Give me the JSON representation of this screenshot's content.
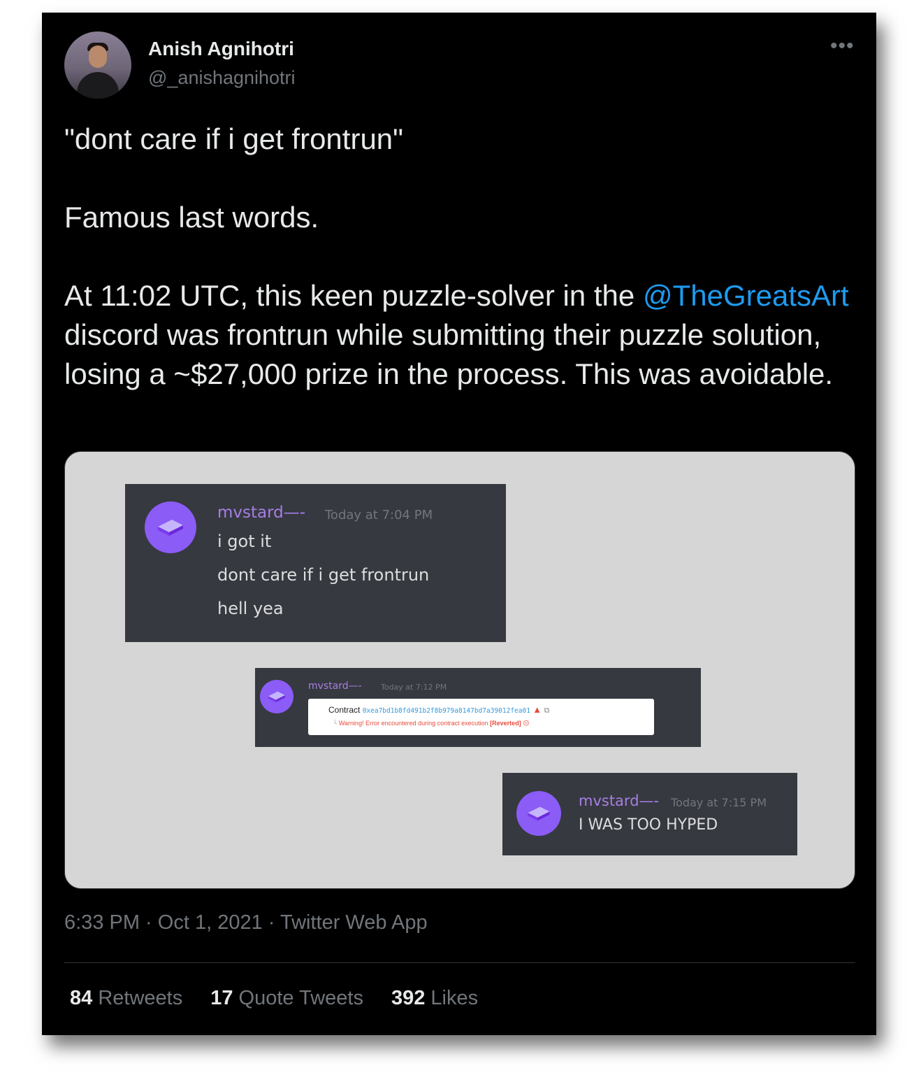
{
  "author": {
    "name": "Anish Agnihotri",
    "handle": "@_anishagnihotri"
  },
  "tweet": {
    "line1": "\"dont care if i get frontrun\"",
    "line2": "Famous last words.",
    "line3_before": "At 11:02 UTC, this keen puzzle-solver in the ",
    "mention": "@TheGreatsArt",
    "line3_after": " discord was frontrun while submitting their puzzle solution, losing a ~$27,000 prize in the process. This was avoidable."
  },
  "media": {
    "msg1": {
      "username": "mvstard—-",
      "timestamp": "Today at 7:04 PM",
      "lines": [
        "i got it",
        "dont care if i get frontrun",
        "hell yea"
      ]
    },
    "msg2": {
      "username": "mvstard—-",
      "timestamp": "Today at 7:12 PM",
      "contract_label": "Contract",
      "contract_address": "0xea7bd1b8fd491b2f8b979a8147bd7a39012fea01",
      "warning_prefix": "Warning! Error encountered during contract execution ",
      "warning_status": "[Reverted]"
    },
    "msg3": {
      "username": "mvstard—-",
      "timestamp": "Today at 7:15 PM",
      "line": "I WAS TOO HYPED"
    }
  },
  "meta": {
    "time": "6:33 PM",
    "date": "Oct 1, 2021",
    "source": "Twitter Web App",
    "separator": " · "
  },
  "stats": {
    "retweets_count": "84",
    "retweets_label": "Retweets",
    "quotes_count": "17",
    "quotes_label": "Quote Tweets",
    "likes_count": "392",
    "likes_label": "Likes"
  },
  "icons": {
    "more": "more-icon",
    "avatar": "brick-icon",
    "warning": "warning-icon",
    "copy": "copy-icon"
  },
  "colors": {
    "background": "#000000",
    "text": "#e7e9ea",
    "secondary": "#71767b",
    "mention": "#1d9bf0",
    "discord_bg": "#36393f",
    "discord_username": "#a77ee6",
    "discord_avatar": "#8b5cf6",
    "address_link": "#3498db",
    "warning": "#e74c3c"
  }
}
